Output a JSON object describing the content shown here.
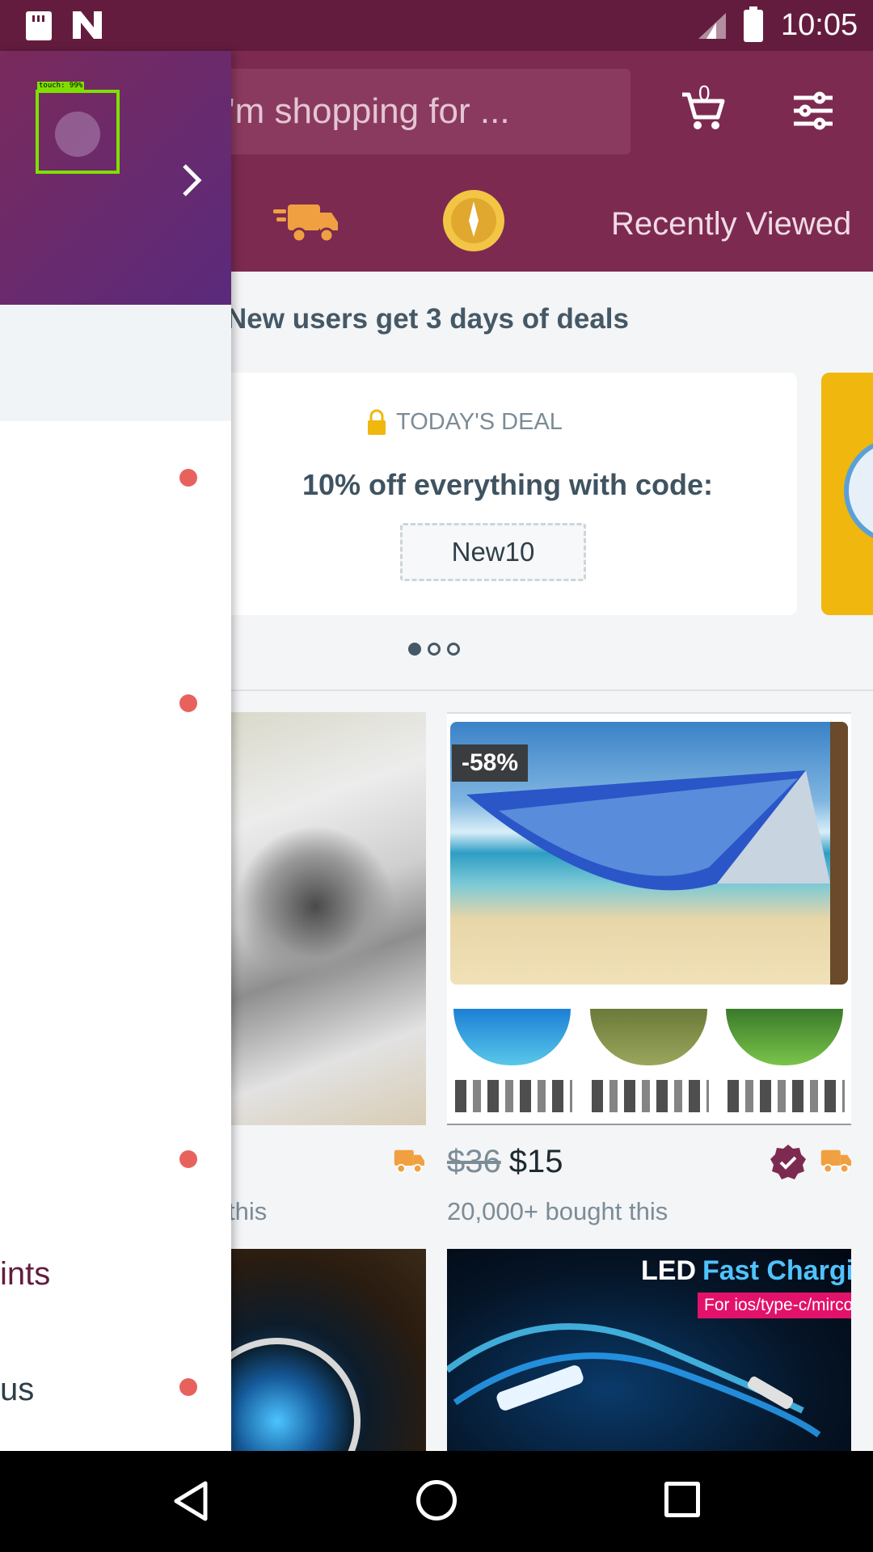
{
  "status_bar": {
    "time": "10:05",
    "network": "LTE"
  },
  "header": {
    "search_placeholder": "I'm shopping for ...",
    "cart_count": "0",
    "quick_links": {
      "recently_viewed": "Recently Viewed"
    }
  },
  "banner": {
    "headline": "New users get 3 days of deals",
    "deal_tag": "TODAY'S DEAL",
    "deal_title": "10% off everything with code:",
    "deal_code": "New10",
    "carousel_active_index": 0,
    "carousel_count": 3
  },
  "products": [
    {
      "bought": "this"
    },
    {
      "discount": "-58%",
      "old_price": "$36",
      "price": "$15",
      "bought": "20,000+ bought this"
    },
    {},
    {
      "title_white": "LED",
      "title_blue": "Fast Charging",
      "badge": "For ios/type-c/mirco"
    }
  ],
  "drawer": {
    "items": [
      {
        "label": "ints"
      },
      {
        "label": "us"
      }
    ],
    "touch_label": "touch: 99%"
  },
  "colors": {
    "brand": "#7d2a51",
    "status_bar": "#641c3e",
    "accent_orange": "#f0a040",
    "notification_dot": "#e8625d"
  }
}
